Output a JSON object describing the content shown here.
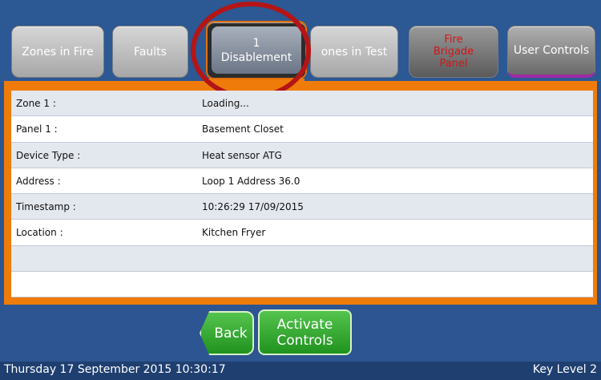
{
  "tabs": {
    "zones_in_fire": "Zones in Fire",
    "faults": "Faults",
    "disablement_count": "1",
    "disablement": "Disablement",
    "zones_in_test": "ones in Test",
    "fire_brigade_line1": "Fire",
    "fire_brigade_line2": "Brigade",
    "fire_brigade_line3": "Panel",
    "user_controls": "User Controls"
  },
  "details": {
    "rows": [
      {
        "label": "Zone 1 :",
        "value": "Loading..."
      },
      {
        "label": "Panel 1 :",
        "value": "Basement Closet"
      },
      {
        "label": "Device Type :",
        "value": "Heat sensor ATG"
      },
      {
        "label": "Address :",
        "value": "Loop 1 Address 36.0"
      },
      {
        "label": "Timestamp :",
        "value": "10:26:29 17/09/2015"
      },
      {
        "label": "Location :",
        "value": "Kitchen Fryer"
      },
      {
        "label": "",
        "value": ""
      },
      {
        "label": "",
        "value": ""
      }
    ]
  },
  "actions": {
    "back": "Back",
    "activate_line1": "Activate",
    "activate_line2": "Controls"
  },
  "status": {
    "datetime": "Thursday 17 September 2015 10:30:17",
    "key_level": "Key Level 2"
  },
  "colors": {
    "frame_blue": "#2c5591",
    "panel_orange": "#ef7c0a",
    "button_green": "#20921e",
    "alert_red": "#d01616",
    "annotation_circle": "#b41516"
  }
}
